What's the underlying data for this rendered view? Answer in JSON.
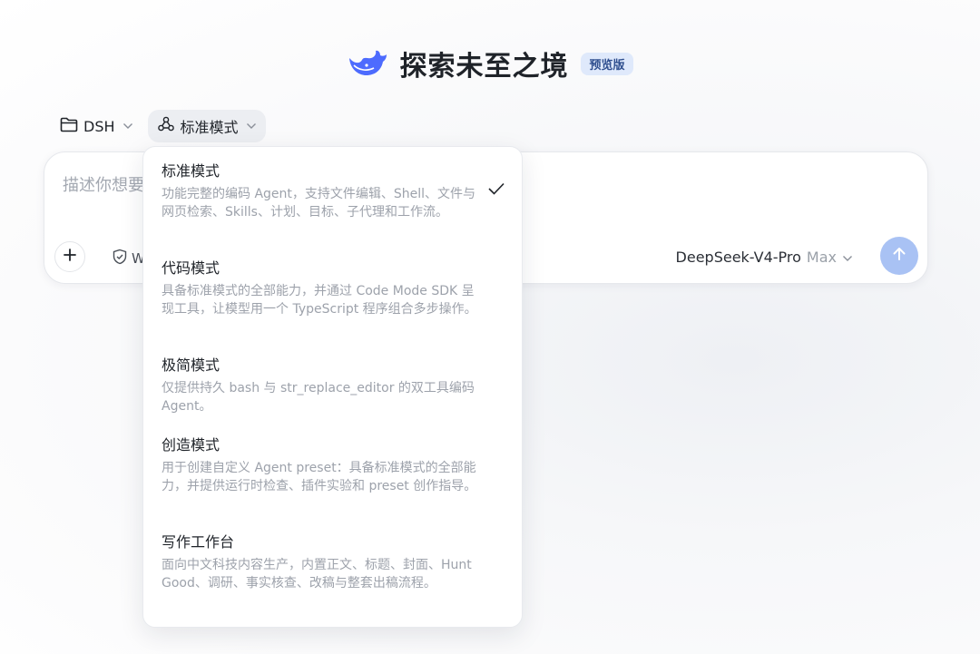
{
  "header": {
    "title": "探索未至之境",
    "badge": "预览版"
  },
  "toolbar": {
    "project_label": "DSH",
    "mode_label": "标准模式"
  },
  "composer": {
    "placeholder": "描述你想要",
    "web_label": "W",
    "model_name": "DeepSeek-V4-Pro",
    "model_tier": "Max"
  },
  "dropdown": {
    "selected_index": 0,
    "modes": [
      {
        "name": "标准模式",
        "desc": "功能完整的编码 Agent，支持文件编辑、Shell、文件与网页检索、Skills、计划、目标、子代理和工作流。"
      },
      {
        "name": "代码模式",
        "desc": "具备标准模式的全部能力，并通过 Code Mode SDK 呈现工具，让模型用一个 TypeScript 程序组合多步操作。"
      },
      {
        "name": "极简模式",
        "desc": "仅提供持久 bash 与 str_replace_editor 的双工具编码 Agent。"
      },
      {
        "name": "创造模式",
        "desc": "用于创建自定义 Agent preset：具备标准模式的全部能力，并提供运行时检查、插件实验和 preset 创作指导。"
      },
      {
        "name": "写作工作台",
        "desc": "面向中文科技内容生产，内置正文、标题、封面、Hunt Good、调研、事实核查、改稿与整套出稿流程。"
      }
    ]
  },
  "colors": {
    "accent": "#4d6bfe",
    "send_button": "#a9c2f4",
    "badge_bg": "#dfe9fb"
  },
  "icons": [
    "whale-logo-icon",
    "folder-icon",
    "mode-icon",
    "chevron-down-icon",
    "plus-icon",
    "web-search-icon",
    "arrow-up-icon",
    "checkmark-icon"
  ]
}
